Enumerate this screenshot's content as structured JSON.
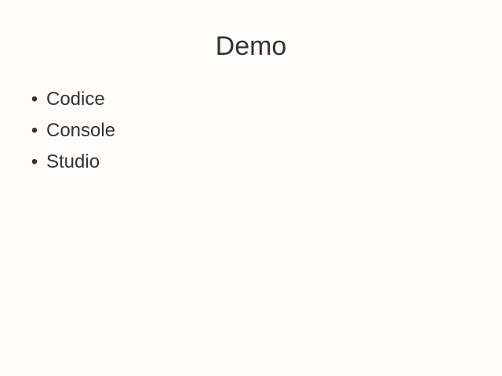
{
  "slide": {
    "title": "Demo",
    "items": [
      {
        "label": "Codice"
      },
      {
        "label": "Console"
      },
      {
        "label": "Studio"
      }
    ]
  },
  "colors": {
    "background": "#fdfcfb",
    "text": "#333333"
  }
}
